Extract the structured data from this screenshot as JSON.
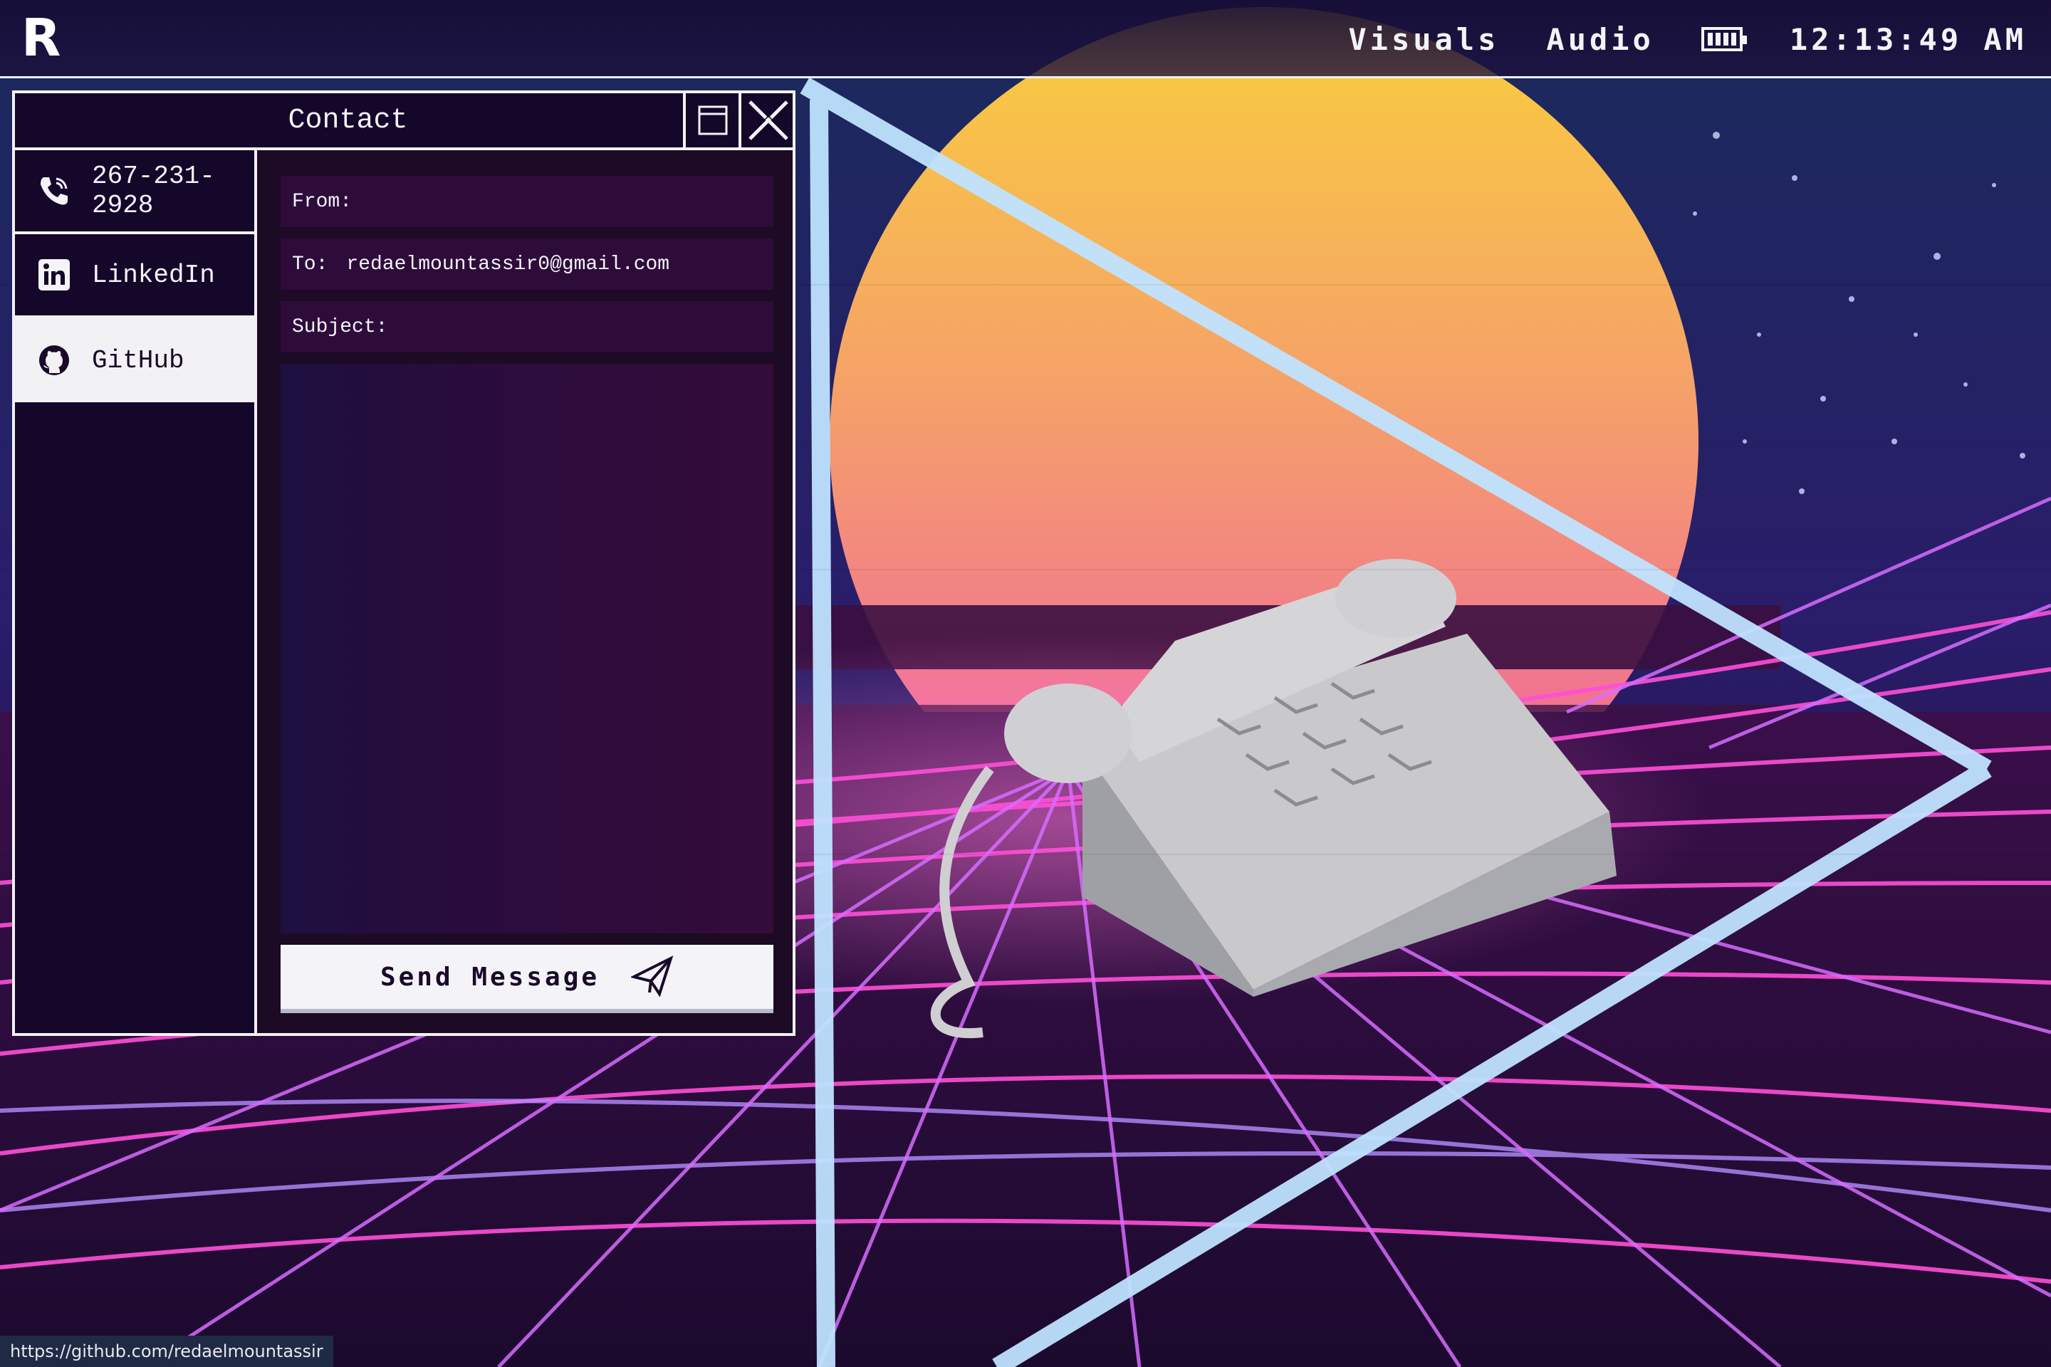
{
  "topbar": {
    "logo": "R",
    "nav": [
      "Visuals",
      "Audio"
    ],
    "battery_icon": "battery-icon",
    "clock": "12:13:49 AM"
  },
  "window": {
    "title": "Contact",
    "maximize_icon": "maximize-icon",
    "close_icon": "close-icon",
    "sidebar": [
      {
        "label": "267-231-2928",
        "icon": "phone-icon",
        "active": false
      },
      {
        "label": "LinkedIn",
        "icon": "linkedin-icon",
        "active": false
      },
      {
        "label": "GitHub",
        "icon": "github-icon",
        "active": true
      }
    ],
    "form": {
      "from_label": "From:",
      "from_value": "",
      "to_label": "To:",
      "to_value": "redaelmountassir0@gmail.com",
      "subject_label": "Subject:",
      "subject_value": "",
      "message_value": "",
      "send_label": "Send Message",
      "send_icon": "send-icon"
    }
  },
  "status_url": "https://github.com/redaelmountassir",
  "colors": {
    "accent": "#f2f2f4",
    "window_bg": "#1a0a2a",
    "field_bg": "#2e0c3a",
    "sun_top": "#f7c23a",
    "sun_bottom": "#f06aa0",
    "grid": "#ff4fd8"
  }
}
